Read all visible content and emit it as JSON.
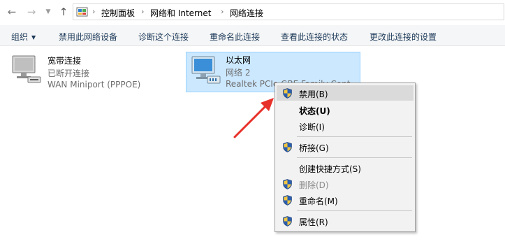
{
  "address": {
    "crumbs": [
      "控制面板",
      "网络和 Internet",
      "网络连接"
    ]
  },
  "commands": {
    "organize": "组织",
    "disable": "禁用此网络设备",
    "diagnose": "诊断这个连接",
    "rename": "重命名此连接",
    "status": "查看此连接的状态",
    "settings": "更改此连接的设置"
  },
  "connections": [
    {
      "name": "宽带连接",
      "status": "已断开连接",
      "device": "WAN Miniport (PPPOE)"
    },
    {
      "name": "以太网",
      "status": "网络 2",
      "device": "Realtek PCIe GBE Family Cont"
    }
  ],
  "context_menu": {
    "disable": "禁用(B)",
    "status": "状态(U)",
    "diagnose": "诊断(I)",
    "bridge": "桥接(G)",
    "shortcut": "创建快捷方式(S)",
    "delete": "删除(D)",
    "rename": "重命名(M)",
    "properties": "属性(R)"
  },
  "colors": {
    "selection_fill": "#cce8ff",
    "menu_highlight": "#dadada",
    "annotation_arrow": "#e8302a"
  },
  "icons": [
    "back-icon",
    "forward-icon",
    "recent-dropdown-icon",
    "up-icon",
    "control-panel-icon",
    "network-adapter-icon",
    "uac-shield-icon"
  ]
}
